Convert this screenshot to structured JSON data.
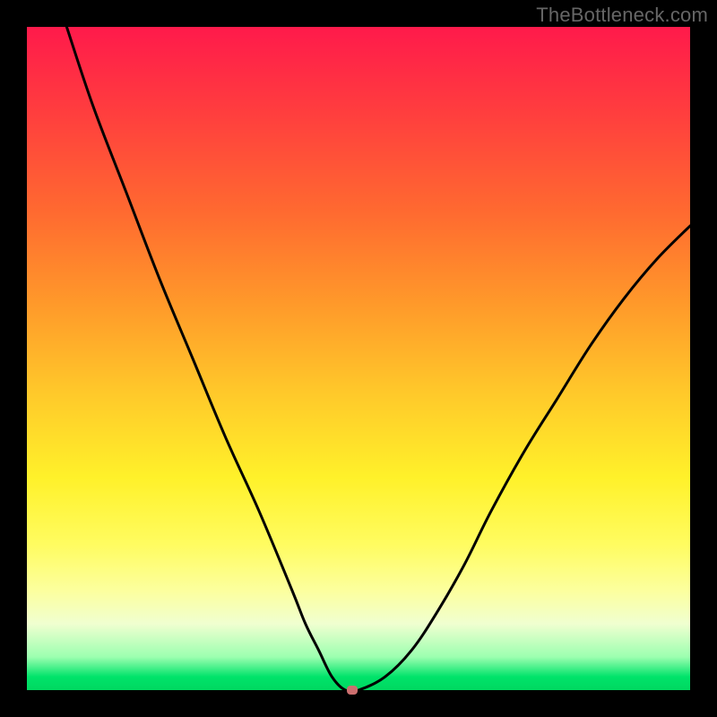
{
  "watermark": "TheBottleneck.com",
  "chart_data": {
    "type": "line",
    "title": "",
    "xlabel": "",
    "ylabel": "",
    "xlim": [
      0,
      100
    ],
    "ylim": [
      0,
      100
    ],
    "grid": false,
    "legend": false,
    "series": [
      {
        "name": "curve",
        "x": [
          6,
          10,
          15,
          20,
          25,
          30,
          35,
          40,
          42,
          44,
          46,
          48,
          50,
          54,
          58,
          62,
          66,
          70,
          75,
          80,
          85,
          90,
          95,
          100
        ],
        "y": [
          100,
          88,
          75,
          62,
          50,
          38,
          27,
          15,
          10,
          6,
          2,
          0,
          0,
          2,
          6,
          12,
          19,
          27,
          36,
          44,
          52,
          59,
          65,
          70
        ]
      }
    ],
    "marker": {
      "x": 49,
      "y": 0
    },
    "background": "red-yellow-green vertical gradient",
    "frame": "black"
  }
}
